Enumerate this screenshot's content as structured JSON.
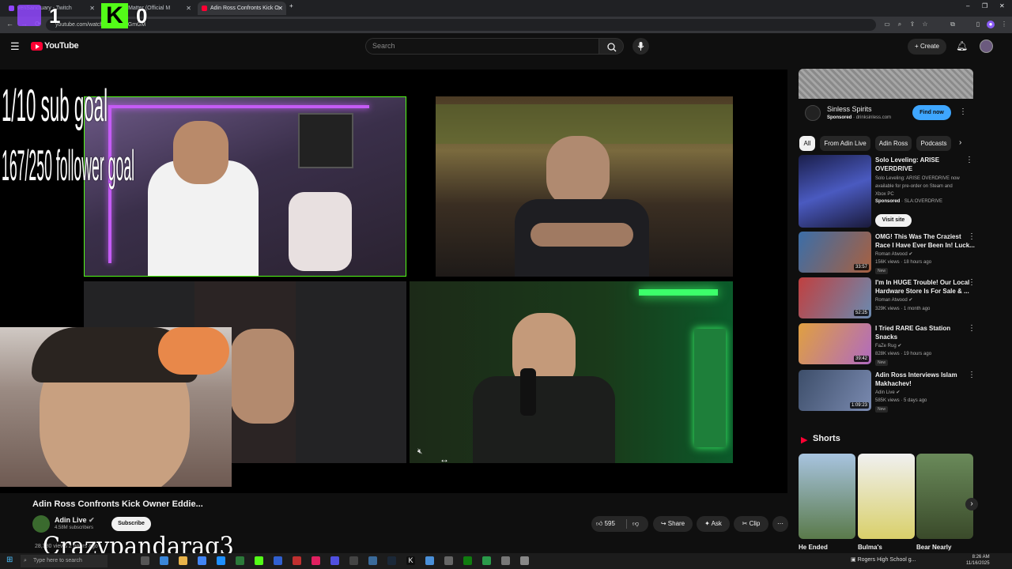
{
  "browser": {
    "tabs": [
      {
        "label": "venSanctuary - Twitch",
        "active": false
      },
      {
        "label": "Don't Matter (Official M",
        "active": false
      },
      {
        "label": "Adin Ross Confronts Kick O",
        "active": true
      }
    ],
    "url": "youtube.com/watch?v=...1TruGmGM",
    "new_tab": "+",
    "window": {
      "min": "–",
      "max": "❐",
      "close": "✕"
    }
  },
  "stream_overlay": {
    "counter_left": "1",
    "counter_right": "0",
    "kick_logo": "K",
    "sub_goal": "1/10 sub goal",
    "follower_goal": "167/250 follower goal",
    "streamer_name": "Crazypandarag3"
  },
  "youtube": {
    "logo_text": "YouTube",
    "search_placeholder": "Search",
    "create_label": "Create",
    "video_title": "Adin Ross Confronts Kick Owner Eddie...",
    "channel_name": "Adin Live",
    "subscribers": "4.58M subscribers",
    "subscribe_label": "Subscribe",
    "views_partial": "28,380 views  2 hours ago",
    "like_count": "595",
    "share_label": "Share",
    "ask_label": "Ask",
    "clip_label": "Clip"
  },
  "ad": {
    "brand": "Sinless Spirits",
    "sponsored": "Sponsored",
    "domain": "drinksinless.com",
    "cta": "Find now"
  },
  "chips": [
    "All",
    "From Adin Live",
    "Adin Ross",
    "Podcasts"
  ],
  "recommendations": [
    {
      "title_lines": [
        "Solo Leveling: ARISE",
        "OVERDRIVE"
      ],
      "meta": [
        "Solo Leveling: ARISE OVERDRIVE now",
        "available for pre-order on Steam and",
        "Xbox PC"
      ],
      "sponsor": "Sponsored",
      "sponsor_tag": "SLA:OVERDRIVE",
      "cta": "Visit site",
      "duration": "",
      "thumb_color": "#2a2d6e"
    },
    {
      "title_lines": [
        "OMG! This Was The Craziest",
        "Race I Have Ever Been In! Luck..."
      ],
      "channel": "Roman Atwood",
      "meta": [
        "156K views · 18 hours ago"
      ],
      "badge": "New",
      "duration": "33:57",
      "thumb_color": "#3b6ea8"
    },
    {
      "title_lines": [
        "I'm In HUGE Trouble! Our Local",
        "Hardware Store Is For Sale & ..."
      ],
      "channel": "Roman Atwood",
      "meta": [
        "329K views · 1 month ago"
      ],
      "duration": "52:25",
      "thumb_color": "#8a3a3a"
    },
    {
      "title_lines": [
        "I Tried RARE Gas Station",
        "Snacks"
      ],
      "channel": "FaZe Rug",
      "meta": [
        "828K views · 19 hours ago"
      ],
      "badge": "New",
      "duration": "39:42",
      "thumb_color": "#b06ac0"
    },
    {
      "title_lines": [
        "Adin Ross Interviews Islam",
        "Makhachev!"
      ],
      "channel": "Adin Live",
      "meta": [
        "585K views · 5 days ago"
      ],
      "badge": "New",
      "duration": "1:09:23",
      "thumb_color": "#3d4e6a"
    }
  ],
  "shorts": {
    "heading": "Shorts",
    "items": [
      {
        "title": "He Ended",
        "color": "#7aa0c4"
      },
      {
        "title": "Bulma's",
        "color": "#d9d06a"
      },
      {
        "title": "Bear Nearly",
        "color": "#7c8e5a"
      }
    ]
  },
  "taskbar": {
    "search_placeholder": "Type here to search",
    "notification": "Rogers High School g...",
    "time": "8:26 AM",
    "date": "11/16/2025"
  },
  "colors": {
    "yt_red": "#ff0033",
    "find_now_blue": "#3ea6ff",
    "kick_green": "#53fc18",
    "twitch_purple": "#9146ff"
  }
}
